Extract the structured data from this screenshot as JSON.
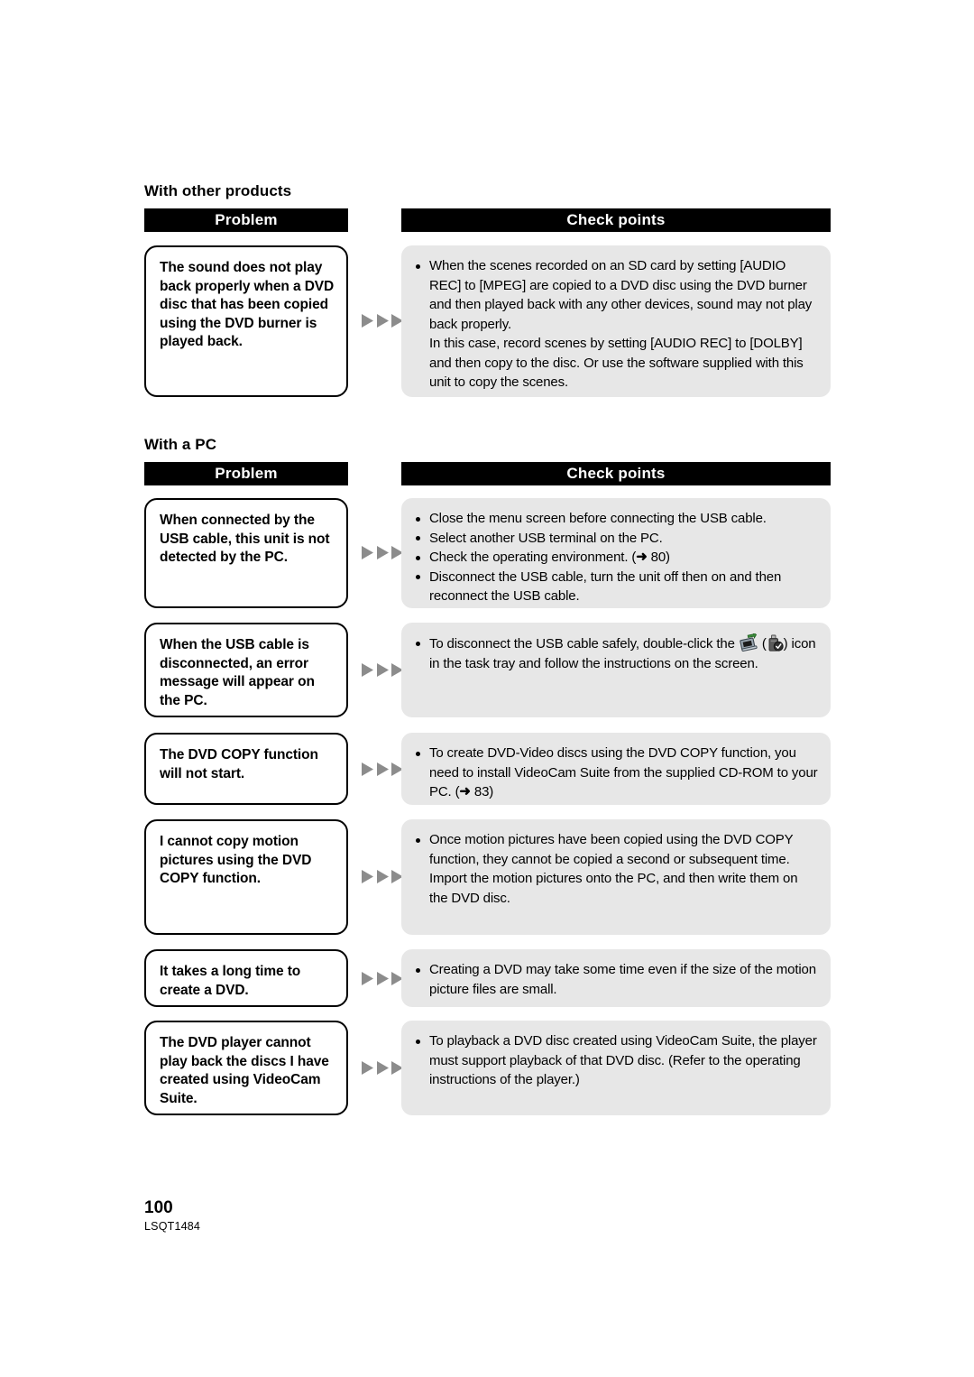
{
  "page": {
    "number": "100",
    "document_code": "LSQT1484",
    "background": "#ffffff",
    "accent_header_bg": "#000000",
    "checkpoint_bg": "#e7e7e7",
    "arrow_color": "#8c8c8c"
  },
  "columns": {
    "problem_label": "Problem",
    "checkpoints_label": "Check points"
  },
  "sections": [
    {
      "heading": "With other products",
      "rows": [
        {
          "problem": "The sound does not play back properly when a DVD disc that has been copied using the DVD burner is played back.",
          "checkpoints": [
            {
              "lines": [
                "When the scenes recorded on an SD card by setting [AUDIO REC] to [MPEG] are copied to a DVD disc using the DVD burner and then played back with any other devices, sound may not play back properly.",
                "In this case, record scenes by setting [AUDIO REC] to [DOLBY] and then copy to the disc. Or use the software supplied with this unit to copy the scenes."
              ]
            }
          ]
        }
      ]
    },
    {
      "heading": "With a PC",
      "rows": [
        {
          "problem": "When connected by the USB cable, this unit is not detected by the PC.",
          "checkpoints": [
            {
              "lines": [
                "Close the menu screen before connecting the USB cable."
              ]
            },
            {
              "lines": [
                "Select another USB terminal on the PC."
              ]
            },
            {
              "lines": [
                "Check the operating environment. ("
              ],
              "ref_arrow": "➜",
              "ref_page": "80",
              "tail": ")"
            },
            {
              "lines": [
                "Disconnect the USB cable, turn the unit off then on and then reconnect the USB cable."
              ]
            }
          ]
        },
        {
          "problem": "When the USB cable is disconnected, an error message will appear on the PC.",
          "checkpoints": [
            {
              "lines": [
                "To disconnect the USB cable safely, double-click the ",
                " (",
                ") icon in the task tray and follow the instructions on the screen."
              ],
              "icons": [
                "safely-remove-hardware-icon",
                "usb-drive-icon"
              ]
            }
          ]
        },
        {
          "problem": "The DVD COPY function will not start.",
          "checkpoints": [
            {
              "lines": [
                "To create DVD-Video discs using the DVD COPY function, you need to install VideoCam Suite from the supplied CD-ROM to your PC. ("
              ],
              "ref_arrow": "➜",
              "ref_page": "83",
              "tail": ")"
            }
          ]
        },
        {
          "problem": "I cannot copy motion pictures using the DVD COPY function.",
          "checkpoints": [
            {
              "lines": [
                "Once motion pictures have been copied using the DVD COPY function, they cannot be copied a second or subsequent time.",
                "Import the motion pictures onto the PC, and then write them on the DVD disc."
              ]
            }
          ]
        },
        {
          "problem": "It takes a long time to create a DVD.",
          "checkpoints": [
            {
              "lines": [
                "Creating a DVD may take some time even if the size of the motion picture files are small."
              ]
            }
          ]
        },
        {
          "problem": "The DVD player cannot play back the discs I have created using VideoCam Suite.",
          "checkpoints": [
            {
              "lines": [
                "To playback a DVD disc created using VideoCam Suite, the player must support playback of that DVD disc. (Refer to the operating instructions of the player.)"
              ]
            }
          ]
        }
      ]
    }
  ]
}
